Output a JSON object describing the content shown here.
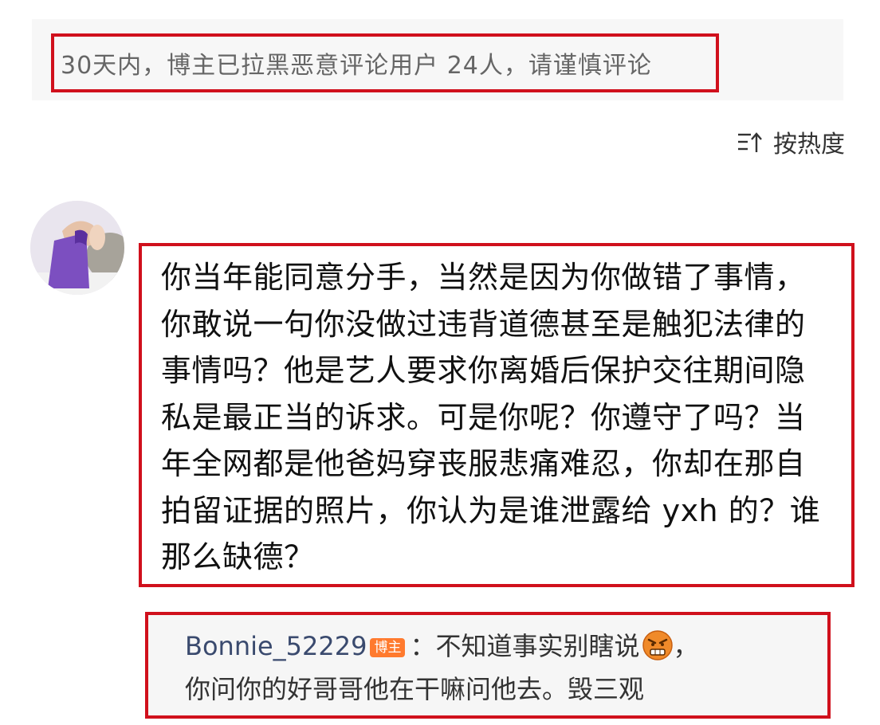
{
  "notice": {
    "text": "30天内，博主已拉黑恶意评论用户 24人，请谨慎评论"
  },
  "sort": {
    "label": "按热度",
    "icon": "sort-icon"
  },
  "comment": {
    "avatar_icon": "user-avatar",
    "text": "你当年能同意分手，当然是因为你做错了事情，你敢说一句你没做过违背道德甚至是触犯法律的事情吗？他是艺人要求你离婚后保护交往期间隐私是最正当的诉求。可是你呢？你遵守了吗？当年全网都是他爸妈穿丧服悲痛难忍，你却在那自拍留证据的照片，你认为是谁泄露给 yxh 的？谁那么缺德？"
  },
  "reply": {
    "username": "Bonnie_52229",
    "badge": "博主",
    "separator": "：",
    "text_part1": "不知道事实别瞎说",
    "emoji": "angry-face-emoji",
    "text_part2": "，",
    "text_line2": "你问你的好哥哥他在干嘛问他去。毁三观"
  },
  "colors": {
    "highlight_border": "#d0101c",
    "username": "#3a4a6e",
    "badge": "#ff7a2e",
    "notice_text": "#666666"
  }
}
